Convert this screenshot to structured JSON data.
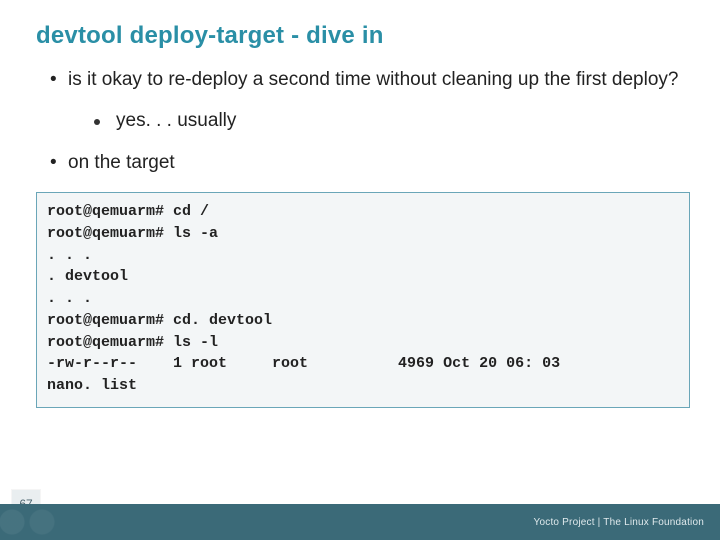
{
  "title": "devtool deploy-target - dive in",
  "bullets": {
    "q1": "is it okay to re-deploy a second time without cleaning up the first deploy?",
    "a1": "yes. . . usually",
    "q2": "on the target"
  },
  "code": "root@qemuarm# cd /\nroot@qemuarm# ls -a\n. . .\n. devtool\n. . .\nroot@qemuarm# cd. devtool\nroot@qemuarm# ls -l\n-rw-r--r--    1 root     root          4969 Oct 20 06: 03\nnano. list",
  "footer": {
    "slide_number": "67",
    "attribution": "Yocto Project | The Linux Foundation"
  }
}
